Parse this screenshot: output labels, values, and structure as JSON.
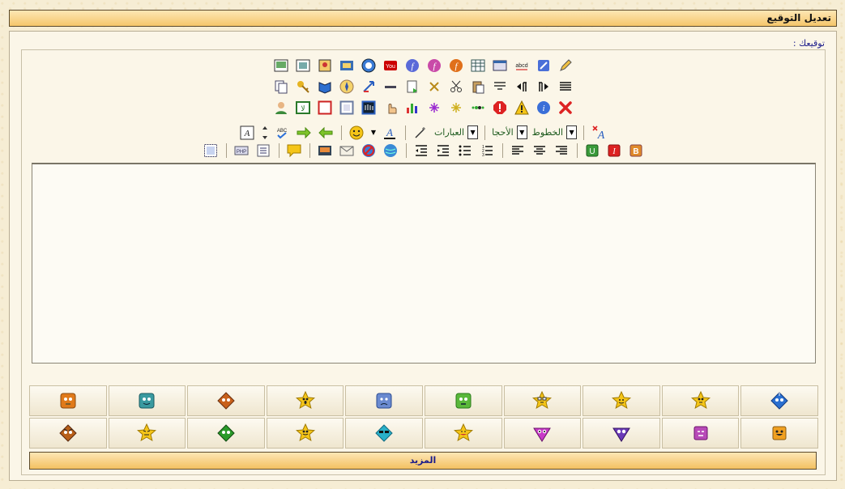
{
  "header": {
    "title": "تعديل التوقيع"
  },
  "signature": {
    "label": "توقيعك :"
  },
  "toolbar": {
    "fonts_label": "الخطوط",
    "sizes_label": "الأحجا",
    "phrases_label": "العبارات",
    "rows": [
      [
        "image-icon",
        "box-image-icon",
        "photo-icon",
        "film-icon",
        "quicktime-icon",
        "youtube-icon",
        "flash-blue-icon",
        "flash-pink-icon",
        "flash-orange-icon",
        "table-icon",
        "window-icon",
        "spellcheck-abcd-icon",
        "paint-icon",
        "edit-icon"
      ],
      [
        "copy-icon",
        "key-icon",
        "book-icon",
        "compass-icon",
        "arrows-icon",
        "horizontal-rule-icon",
        "export-icon",
        "close-x-icon",
        "cut-icon",
        "paste-icon",
        "format-icon",
        "rtl-icon",
        "ltr-icon",
        "justify-icon"
      ],
      [
        "user-icon",
        "quote-icon",
        "frame-red-icon",
        "frame-icon",
        "frame-blue-icon",
        "hand-icon",
        "chart-icon",
        "sparkle-purple-icon",
        "sparkle-yellow-icon",
        "dots-icon",
        "stop-icon",
        "warning-icon",
        "info-icon",
        "delete-icon"
      ]
    ]
  },
  "more_button": {
    "label": "المزيد"
  },
  "colors": {
    "header_bg": "#f5c66a",
    "panel_bg": "#fbf6e8",
    "label_color": "#1b1b8a"
  },
  "smileys": [
    "orange-square-face-icon",
    "teal-square-face-icon",
    "brown-diamond-face-icon",
    "angry-star-face-icon",
    "blue-square-sad-icon",
    "green-square-face-icon",
    "glasses-star-face-icon",
    "happy-star-face-icon",
    "thinking-star-face-icon",
    "blue-diamond-face-icon",
    "brown-diamond-angry-icon",
    "grumpy-star-face-icon",
    "green-diamond-face-icon",
    "smiling-star-face-icon",
    "cool-diamond-face-icon",
    "grin-star-face-icon",
    "magenta-diamond-face-icon",
    "purple-diamond-face-icon",
    "purple-square-face-icon",
    "orange-square-grin-icon"
  ]
}
